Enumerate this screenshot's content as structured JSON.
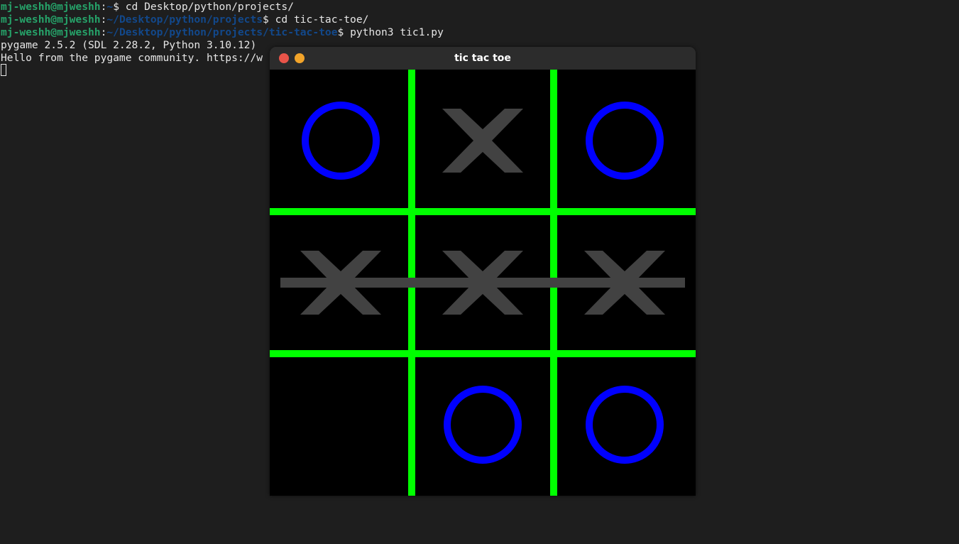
{
  "terminal": {
    "user_host": "mj-weshh@mjweshh",
    "lines": [
      {
        "path": "~",
        "command": "cd Desktop/python/projects/"
      },
      {
        "path": "~/Desktop/python/projects",
        "command": "cd tic-tac-toe/"
      },
      {
        "path": "~/Desktop/python/projects/tic-tac-toe",
        "command": "python3 tic1.py"
      }
    ],
    "output": [
      "pygame 2.5.2 (SDL 2.28.2, Python 3.10.12)",
      "Hello from the pygame community. https://w"
    ]
  },
  "window": {
    "title": "tic tac toe"
  },
  "game": {
    "board": [
      [
        "O",
        "X",
        "O"
      ],
      [
        "X",
        "X",
        "X"
      ],
      [
        "",
        "O",
        "O"
      ]
    ],
    "win_line": {
      "type": "row",
      "index": 1
    },
    "colors": {
      "background": "#000000",
      "grid": "#00ff00",
      "x": "#424242",
      "o": "#0000ff",
      "win_line": "#424242"
    }
  }
}
